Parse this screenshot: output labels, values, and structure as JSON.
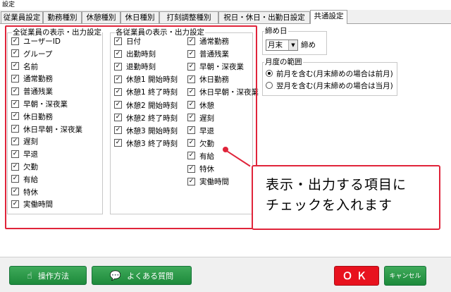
{
  "window": {
    "title": "設定"
  },
  "tabs": [
    {
      "label": "従業員設定",
      "active": false
    },
    {
      "label": "勤務種別",
      "active": false
    },
    {
      "label": "休憩種別",
      "active": false
    },
    {
      "label": "休日種別",
      "active": false
    },
    {
      "label": "打刻調整種別",
      "active": false
    },
    {
      "label": "祝日・休日・出勤日設定",
      "active": false
    },
    {
      "label": "共通設定",
      "active": true
    }
  ],
  "all_employee_group": {
    "title": "全従業員の表示・出力設定",
    "items": [
      {
        "label": "ユーザーID",
        "checked": true
      },
      {
        "label": "グループ",
        "checked": true
      },
      {
        "label": "名前",
        "checked": true
      },
      {
        "label": "通常勤務",
        "checked": true
      },
      {
        "label": "普通残業",
        "checked": true
      },
      {
        "label": "早朝・深夜業",
        "checked": true
      },
      {
        "label": "休日勤務",
        "checked": true
      },
      {
        "label": "休日早朝・深夜業",
        "checked": true
      },
      {
        "label": "遅刻",
        "checked": true
      },
      {
        "label": "早退",
        "checked": true
      },
      {
        "label": "欠勤",
        "checked": true
      },
      {
        "label": "有給",
        "checked": true
      },
      {
        "label": "特休",
        "checked": true
      },
      {
        "label": "実働時間",
        "checked": true
      }
    ]
  },
  "each_employee_group": {
    "title": "各従業員の表示・出力設定",
    "col1": [
      {
        "label": "日付",
        "checked": true
      },
      {
        "label": "出勤時刻",
        "checked": true
      },
      {
        "label": "退勤時刻",
        "checked": true
      },
      {
        "label": "休憩1 開始時刻",
        "checked": true
      },
      {
        "label": "休憩1 終了時刻",
        "checked": true
      },
      {
        "label": "休憩2 開始時刻",
        "checked": true
      },
      {
        "label": "休憩2 終了時刻",
        "checked": true
      },
      {
        "label": "休憩3 開始時刻",
        "checked": true
      },
      {
        "label": "休憩3 終了時刻",
        "checked": true
      }
    ],
    "col2": [
      {
        "label": "通常勤務",
        "checked": true
      },
      {
        "label": "普通残業",
        "checked": true
      },
      {
        "label": "早朝・深夜業",
        "checked": true
      },
      {
        "label": "休日勤務",
        "checked": true
      },
      {
        "label": "休日早朝・深夜業",
        "checked": true
      },
      {
        "label": "休憩",
        "checked": true
      },
      {
        "label": "遅刻",
        "checked": true
      },
      {
        "label": "早退",
        "checked": true
      },
      {
        "label": "欠勤",
        "checked": true
      },
      {
        "label": "有給",
        "checked": true
      },
      {
        "label": "特休",
        "checked": true
      },
      {
        "label": "実働時間",
        "checked": true
      }
    ]
  },
  "closing": {
    "title": "締め日",
    "value": "月末",
    "suffix": "締め"
  },
  "month_range": {
    "title": "月度の範囲",
    "options": [
      {
        "label": "前月を含む(月末締めの場合は前月)",
        "selected": true
      },
      {
        "label": "翌月を含む(月末締めの場合は当月)",
        "selected": false
      }
    ]
  },
  "callout": {
    "line1": "表示・出力する項目に",
    "line2": "チェックを入れます"
  },
  "footer": {
    "howto_label": "操作方法",
    "faq_label": "よくある質問",
    "ok_label": "ＯＫ",
    "cancel_label": "キャンセル"
  },
  "colors": {
    "accent_red": "#e0243a",
    "button_green": "#1d8a3b",
    "ok_red": "#e8121e"
  }
}
